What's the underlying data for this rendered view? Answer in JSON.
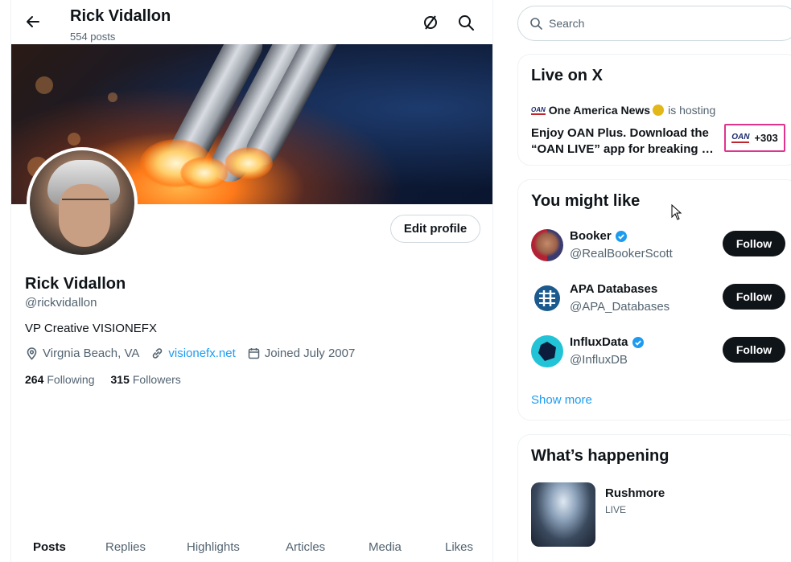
{
  "header": {
    "name": "Rick Vidallon",
    "posts": "554 posts",
    "icons": [
      "back-arrow-icon",
      "grok-icon",
      "search-icon"
    ]
  },
  "profile": {
    "name": "Rick Vidallon",
    "handle": "@rickvidallon",
    "bio": "VP Creative VISIONEFX",
    "location": "Virgnia Beach, VA",
    "website": "visionefx.net",
    "joined": "Joined July 2007",
    "following_count": "264",
    "following_label": "Following",
    "followers_count": "315",
    "followers_label": "Followers",
    "edit_button": "Edit profile"
  },
  "tabs": [
    "Posts",
    "Replies",
    "Highlights",
    "Articles",
    "Media",
    "Likes"
  ],
  "search": {
    "placeholder": "Search"
  },
  "live": {
    "title": "Live on X",
    "host": "One America News",
    "hosting": "is hosting",
    "body": "Enjoy OAN Plus. Download the “OAN LIVE” app for breaking …",
    "badge": "+303",
    "logo_text": "OAN"
  },
  "might_like": {
    "title": "You might like",
    "users": [
      {
        "name": "Booker",
        "handle": "@RealBookerScott",
        "verified": true,
        "follow": "Follow"
      },
      {
        "name": "APA Databases",
        "handle": "@APA_Databases",
        "verified": false,
        "follow": "Follow"
      },
      {
        "name": "InfluxData",
        "handle": "@InfluxDB",
        "verified": true,
        "follow": "Follow"
      }
    ],
    "show_more": "Show more"
  },
  "happening": {
    "title": "What’s happening",
    "trend_name": "Rushmore",
    "trend_status": "LIVE"
  },
  "colors": {
    "accent": "#1d9bf0",
    "text": "#0f1419",
    "muted": "#536471",
    "live_border": "#e0338e"
  }
}
